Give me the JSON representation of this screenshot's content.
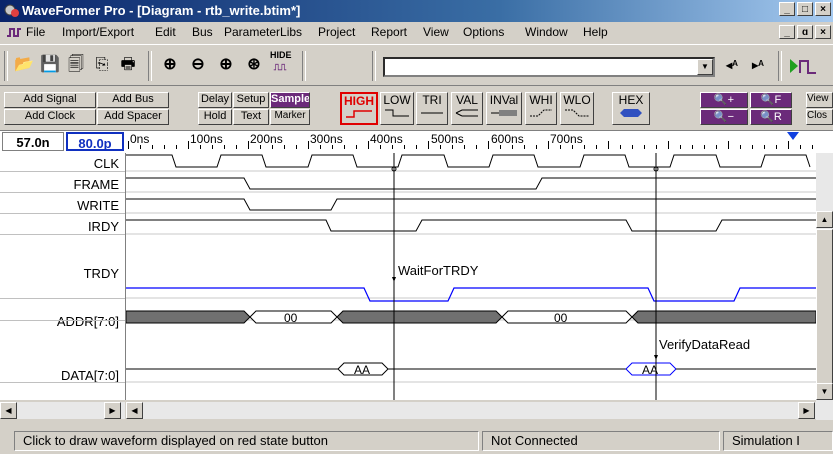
{
  "window": {
    "title": "WaveFormer Pro - [Diagram - rtb_write.btim*]",
    "controls": {
      "min": "_",
      "max": "□",
      "close": "×"
    },
    "child_controls": {
      "min": "_",
      "restore": "ɑ",
      "close": "×"
    }
  },
  "menu": [
    "File",
    "Import/Export",
    "Edit",
    "Bus",
    "ParameterLibs",
    "Project",
    "Report",
    "View",
    "Options",
    "Window",
    "Help"
  ],
  "toolbar": {
    "hide_label": "HIDE",
    "combo_value": ""
  },
  "toolbar2": {
    "add_signal": "Add Signal",
    "add_bus": "Add Bus",
    "add_clock": "Add Clock",
    "add_spacer": "Add Spacer",
    "delay": "Delay",
    "setup": "Setup",
    "sample": "Sample",
    "hold": "Hold",
    "text": "Text",
    "marker": "Marker",
    "states": [
      "HIGH",
      "LOW",
      "TRI",
      "VAL",
      "INVal",
      "WHI",
      "WLO",
      "HEX"
    ],
    "zoom_in_full": "+",
    "zoom_out_full": "−",
    "zoom_f": "F",
    "zoom_r": "R",
    "view": "View",
    "close": "Clos"
  },
  "timebar": {
    "cursor_time": "57.0n",
    "delta_time": "80.0p"
  },
  "ruler": {
    "labels": [
      "0ns",
      "100ns",
      "200ns",
      "300ns",
      "400ns",
      "500ns",
      "600ns",
      "700ns"
    ]
  },
  "signals": [
    {
      "name": "CLK"
    },
    {
      "name": "FRAME"
    },
    {
      "name": "WRITE"
    },
    {
      "name": "IRDY"
    },
    {
      "name": "TRDY"
    },
    {
      "name": "ADDR[7:0]"
    },
    {
      "name": "DATA[7:0]"
    }
  ],
  "waveform": {
    "addr_values": [
      "00",
      "00"
    ],
    "data_values": [
      "AA",
      "AA"
    ],
    "markers": [
      "WaitForTRDY",
      "VerifyDataRead"
    ]
  },
  "statusbar": {
    "hint": "Click to draw waveform displayed on red state button",
    "connection": "Not Connected",
    "mode": "Simulation I"
  },
  "colors": {
    "title_start": "#0a246a",
    "wave_blue": "#0000ff",
    "bus_fill": "#707070",
    "tool_purple": "#6b2a7a"
  }
}
